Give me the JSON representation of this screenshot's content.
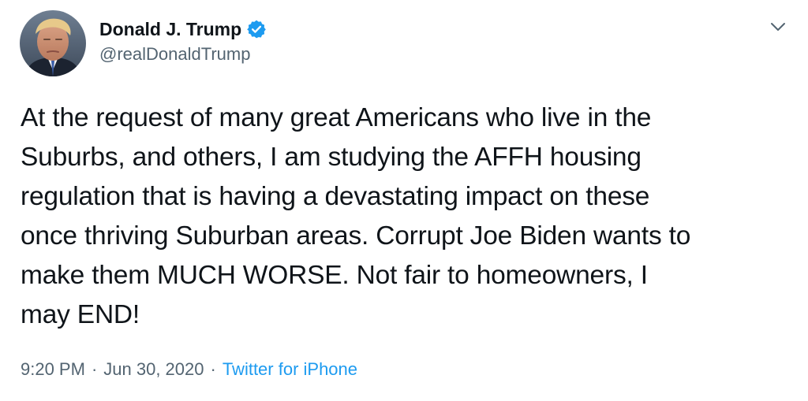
{
  "tweet": {
    "author": {
      "display_name": "Donald J. Trump",
      "handle": "@realDonaldTrump",
      "verified": true,
      "avatar_icon": "profile-photo"
    },
    "text": "At the request of many great Americans who live in the\nSuburbs, and others, I am studying the AFFH housing\nregulation that is having a devastating impact on these\nonce thriving Suburban areas. Corrupt Joe Biden wants to\nmake them MUCH WORSE. Not fair to homeowners, I\nmay END!",
    "time": "9:20 PM",
    "separator": "·",
    "date": "Jun 30, 2020",
    "source": "Twitter for iPhone",
    "menu_icon": "chevron-down-icon"
  },
  "colors": {
    "text_primary": "#0f1419",
    "text_secondary": "#536471",
    "accent": "#1d9bf0",
    "verified_badge": "#1d9bf0",
    "background": "#ffffff"
  }
}
